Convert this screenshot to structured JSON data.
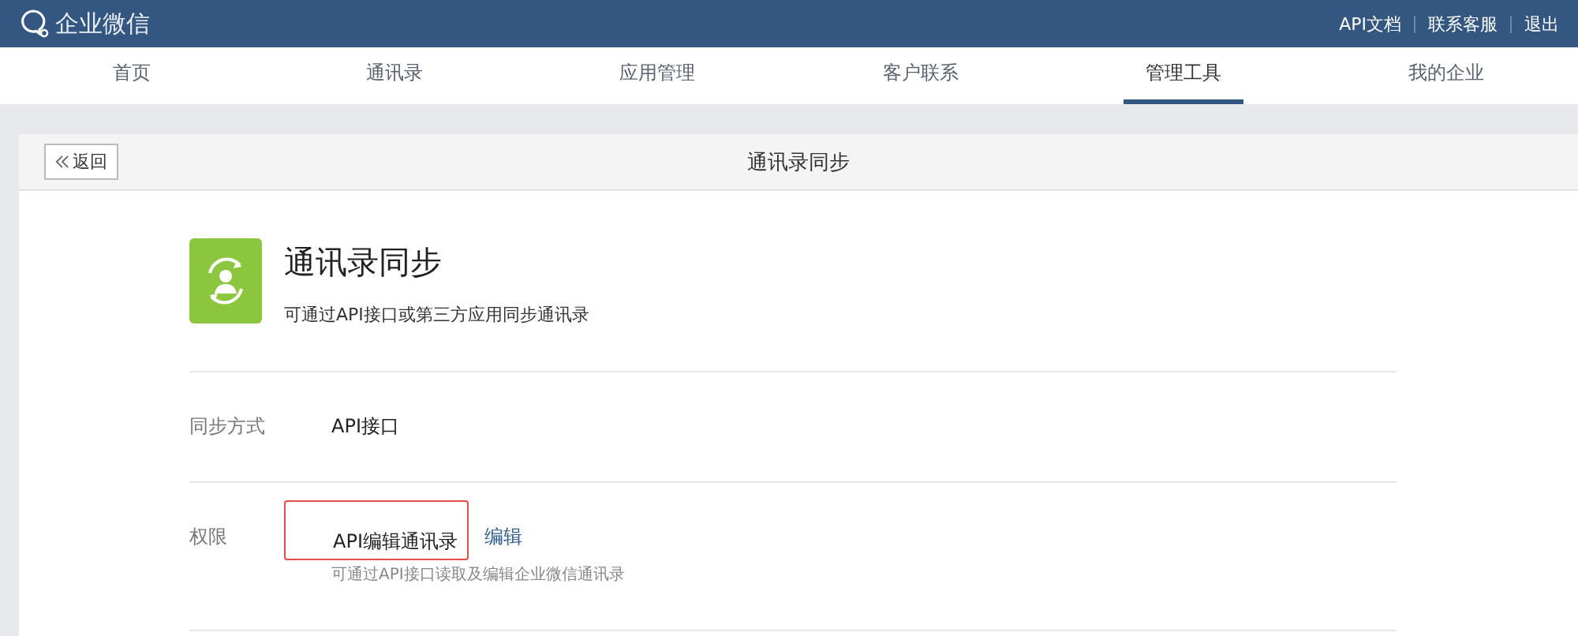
{
  "brand": "企业微信",
  "top_links": [
    "API文档",
    "联系客服",
    "退出"
  ],
  "nav": [
    {
      "label": "首页",
      "selected": false
    },
    {
      "label": "通讯录",
      "selected": false
    },
    {
      "label": "应用管理",
      "selected": false
    },
    {
      "label": "客户联系",
      "selected": false
    },
    {
      "label": "管理工具",
      "selected": true
    },
    {
      "label": "我的企业",
      "selected": false
    }
  ],
  "back_button": "返回",
  "page_title": "通讯录同步",
  "app": {
    "title": "通讯录同步",
    "description": "可通过API接口或第三方应用同步通讯录"
  },
  "rows": [
    {
      "label": "同步方式",
      "value": "API接口",
      "highlighted": false
    },
    {
      "label": "权限",
      "value": "API编辑通讯录",
      "highlighted": true,
      "action": "编辑",
      "hint": "可通过API接口读取及编辑企业微信通讯录"
    }
  ]
}
